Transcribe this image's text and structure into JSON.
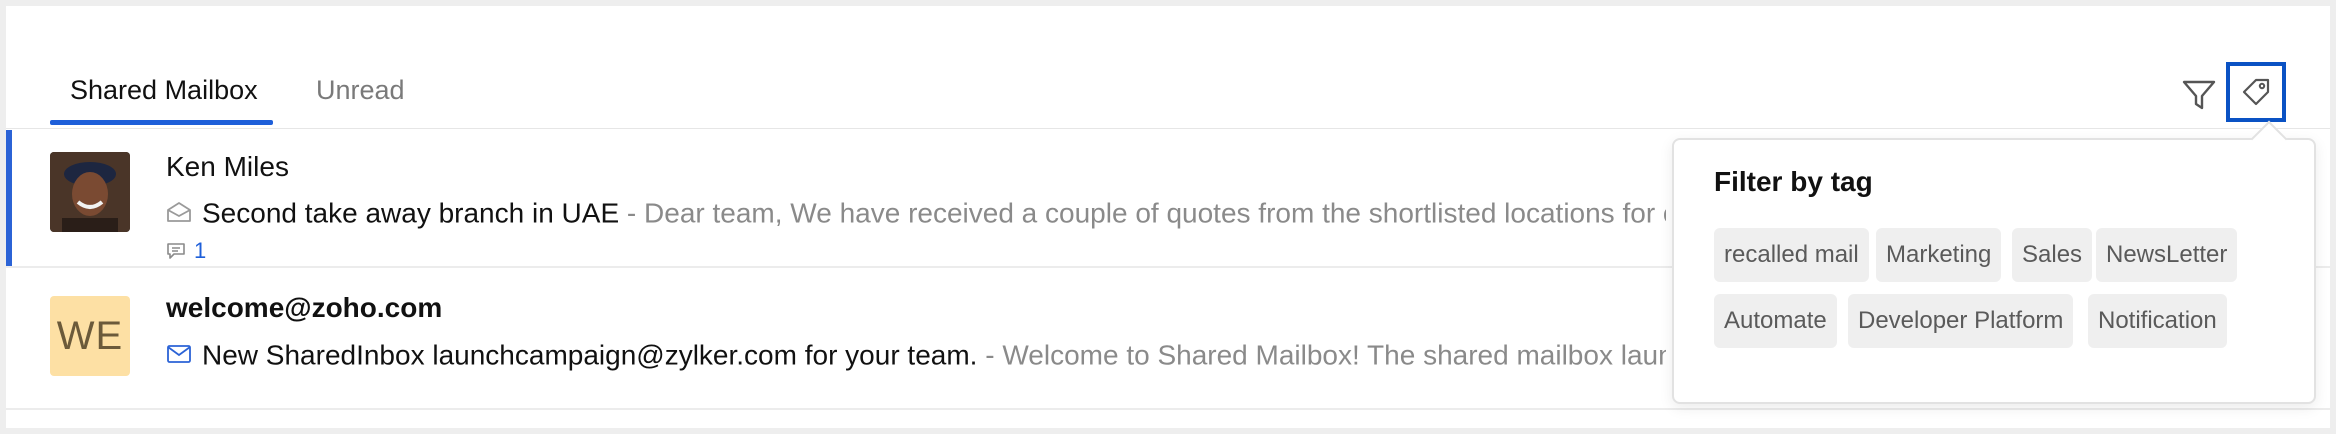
{
  "tabs": [
    {
      "label": "Shared Mailbox",
      "active": true
    },
    {
      "label": "Unread",
      "active": false
    }
  ],
  "toolbar": {
    "filter_icon": "filter-icon",
    "tag_icon": "tag-icon"
  },
  "mails": [
    {
      "sender": "Ken Miles",
      "avatar": "photo",
      "subject": "Second take away branch in UAE",
      "preview": " - Dear team, We have received a couple of quotes from the shortlisted locations for ou",
      "comment_count": "1",
      "read": true
    },
    {
      "sender": "welcome@zoho.com",
      "avatar_initials": "WE",
      "subject": "New SharedInbox launchcampaign@zylker.com for your team.",
      "preview": " - Welcome to Shared Mailbox! The shared mailbox launche",
      "read": false
    }
  ],
  "tag_filter": {
    "title": "Filter by tag",
    "tags": [
      "recalled mail",
      "Marketing",
      "Sales",
      "NewsLetter",
      "Automate",
      "Developer Platform",
      "Notification"
    ]
  },
  "colors": {
    "accent": "#1e5fd9",
    "highlight_border": "#0a52c4",
    "avatar_initials_bg": "#fde0a4"
  }
}
